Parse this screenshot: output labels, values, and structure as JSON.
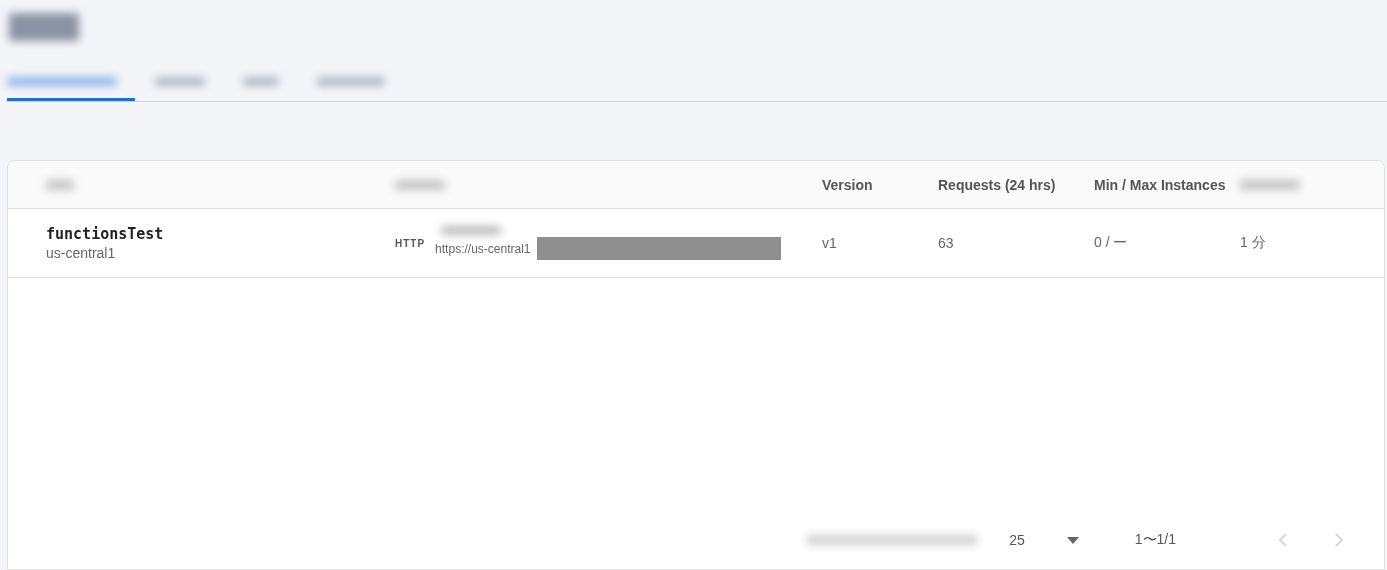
{
  "tabs": [
    {
      "selected": true
    },
    {
      "selected": false
    },
    {
      "selected": false
    },
    {
      "selected": false
    }
  ],
  "table": {
    "columns": [
      {
        "kind": "blurred"
      },
      {
        "kind": "blurred"
      },
      {
        "kind": "text",
        "label": "Version"
      },
      {
        "kind": "text",
        "label": "Requests (24 hrs)"
      },
      {
        "kind": "text",
        "label": "Min / Max Instances"
      },
      {
        "kind": "blurred"
      }
    ],
    "rows": [
      {
        "name": "functionsTest",
        "region": "us-central1",
        "trigger_type": "HTTP",
        "url": "https://us-central1",
        "version": "v1",
        "requests": "63",
        "instances": "0 / ー",
        "timeout": "1 分"
      }
    ]
  },
  "pager": {
    "page_size": "25",
    "range": "1〜1/1",
    "prev_disabled": true,
    "next_disabled": true
  }
}
